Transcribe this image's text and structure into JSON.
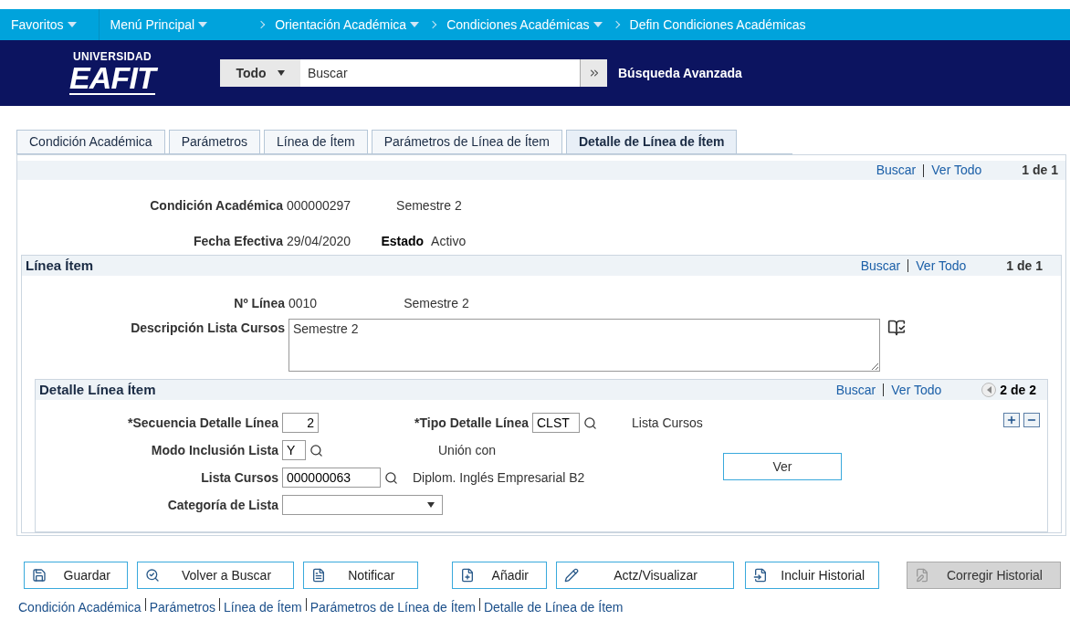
{
  "nav": {
    "items": [
      {
        "label": "Favoritos",
        "dropdown": true
      },
      {
        "label": "Menú Principal",
        "dropdown": true
      }
    ],
    "breadcrumbs": [
      {
        "label": "Orientación Académica",
        "dropdown": true
      },
      {
        "label": "Condiciones Académicas",
        "dropdown": true
      },
      {
        "label": "Defin Condiciones Académicas",
        "dropdown": false
      }
    ]
  },
  "header": {
    "logo_top": "UNIVERSIDAD",
    "logo_main": "EAFIT",
    "search_scope": "Todo",
    "search_placeholder": "Buscar",
    "advanced": "Búsqueda Avanzada"
  },
  "tabs": [
    {
      "label": "Condición Académica",
      "selected": false
    },
    {
      "label": "Parámetros",
      "selected": false
    },
    {
      "label": "Línea de Ítem",
      "selected": false
    },
    {
      "label": "Parámetros de Línea de Ítem",
      "selected": false
    },
    {
      "label": "Detalle de Línea de Ítem",
      "selected": true
    }
  ],
  "main": {
    "find": "Buscar",
    "view_all": "Ver Todo",
    "count": "1 de 1",
    "condicion": {
      "label": "Condición Académica",
      "value": "000000297",
      "desc": "Semestre 2"
    },
    "fecha": {
      "label": "Fecha Efectiva",
      "value": "29/04/2020"
    },
    "estado": {
      "label": "Estado",
      "value": "Activo"
    }
  },
  "linea": {
    "title": "Línea Ítem",
    "find": "Buscar",
    "view_all": "Ver Todo",
    "count": "1 de 1",
    "numero": {
      "label": "Nº Línea",
      "value": "0010",
      "desc": "Semestre 2"
    },
    "descripcion": {
      "label": "Descripción Lista Cursos",
      "value": "Semestre 2"
    }
  },
  "detalle": {
    "title": "Detalle Línea Ítem",
    "find": "Buscar",
    "view_all": "Ver Todo",
    "count": "2 de 2",
    "secuencia": {
      "label": "*Secuencia Detalle Línea",
      "value": "2"
    },
    "tipo": {
      "label": "*Tipo Detalle Línea",
      "value": "CLST",
      "desc": "Lista Cursos"
    },
    "modo": {
      "label": "Modo Inclusión Lista",
      "value": "Y",
      "desc": "Unión con"
    },
    "lista": {
      "label": "Lista Cursos",
      "value": "000000063",
      "desc": "Diplom. Inglés Empresarial B2"
    },
    "categoria": {
      "label": "Categoría de Lista"
    },
    "ver": "Ver"
  },
  "buttons": [
    {
      "label": "Guardar",
      "kind": "save",
      "disabled": false
    },
    {
      "label": "Volver a Buscar",
      "kind": "search",
      "disabled": false
    },
    {
      "label": "Notificar",
      "kind": "notify",
      "disabled": false
    },
    {
      "label": "Añadir",
      "kind": "add",
      "disabled": false
    },
    {
      "label": "Actz/Visualizar",
      "kind": "update",
      "disabled": false
    },
    {
      "label": "Incluir Historial",
      "kind": "history",
      "disabled": false
    },
    {
      "label": "Corregir Historial",
      "kind": "correct",
      "disabled": true
    }
  ],
  "footer_links": [
    "Condición Académica",
    "Parámetros",
    "Línea de Ítem",
    "Parámetros de Línea de Ítem",
    "Detalle de Línea de Ítem"
  ]
}
